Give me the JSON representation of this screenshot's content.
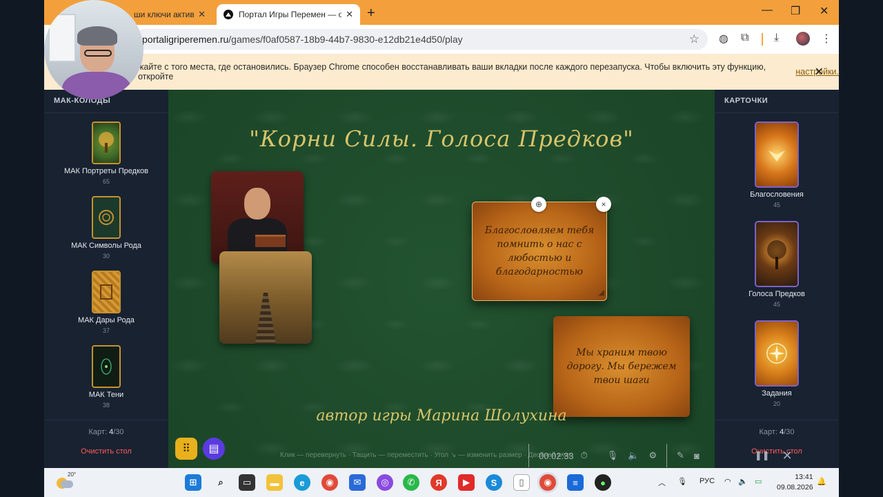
{
  "browser": {
    "tabs": [
      {
        "title": "ши ключи актива",
        "active": false
      },
      {
        "title": "Портал Игры Перемен — онла",
        "active": true
      }
    ],
    "url_host": "portaligriperemen.ru",
    "url_path": "/games/f0af0587-18b9-44b7-9830-e12db21e4d50/play",
    "infobar_text": "жайте с того места, где остановились. Браузер Chrome способен восстанавливать ваши вкладки после каждого перезапуска. Чтобы включить эту функцию, откройте",
    "infobar_link": "настройки."
  },
  "left_panel": {
    "title": "МАК-КОЛОДЫ",
    "decks": [
      {
        "name": "МАК Портреты Предков",
        "count": "65",
        "color": "#3d6a2a"
      },
      {
        "name": "МАК Символы Рода",
        "count": "30",
        "color": "#1c3a2c"
      },
      {
        "name": "МАК Дары Рода",
        "count": "37",
        "color": "#b87a1e"
      },
      {
        "name": "МАК Тени",
        "count": "38",
        "color": "#0f1d14"
      }
    ],
    "cards_label": "Карт: ",
    "cards_value": "4",
    "cards_total": "/30",
    "clear_label": "Очистить стол"
  },
  "right_panel": {
    "title": "КАРТОЧКИ",
    "categories": [
      {
        "name": "Благословения",
        "count": "45",
        "color": "#d7761a"
      },
      {
        "name": "Голоса Предков",
        "count": "45",
        "color": "#3b2a1a"
      },
      {
        "name": "Задания",
        "count": "20",
        "color": "#d9821c"
      }
    ],
    "cards_label": "Карт: ",
    "cards_value": "4",
    "cards_total": "/30",
    "clear_label": "Очистить стол"
  },
  "table": {
    "title": "\"Корни Силы. Голоса Предков\"",
    "author": "автор игры Марина Шолухина",
    "note1": "Благословляем тебя помнить о нас с любостью и благодарностью",
    "note2": "Мы храним твою дорогу. Мы бережем твои шаги",
    "hint": "Клик — перевернуть · Тащить — переместить · Угол ↘ — изменить размер · Двойной клик",
    "move_icon": "⊕",
    "close_icon": "×"
  },
  "recorder": {
    "time": "00:02:33"
  },
  "taskbar": {
    "weather_temp": "20°",
    "lang": "РУС",
    "time": "13:41",
    "date": "09.08.2026"
  },
  "colors": {
    "table_green": "#1f4d2c",
    "title_gold": "#d8c46a",
    "panel_bg": "#182231",
    "danger": "#ff5b5b"
  }
}
